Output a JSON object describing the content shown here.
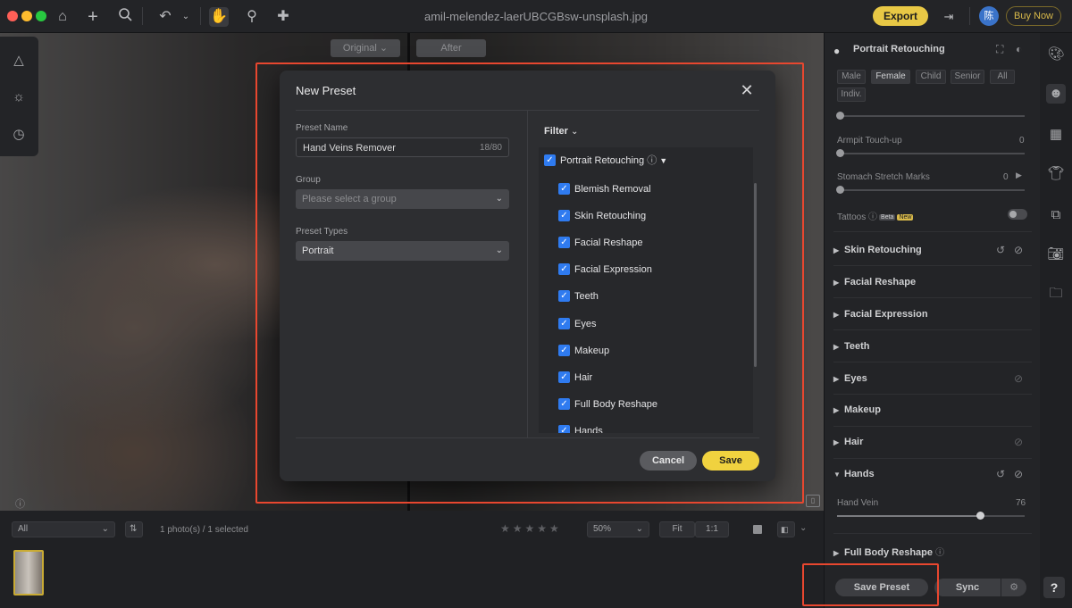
{
  "window": {
    "title": "amil-melendez-laerUBCGBsw-unsplash.jpg"
  },
  "toolbar": {
    "export_label": "Export",
    "avatar_text": "陈",
    "buy_now_label": "Buy Now"
  },
  "viewer": {
    "original_label": "Original",
    "after_label": "After"
  },
  "modal": {
    "title": "New Preset",
    "preset_name_label": "Preset Name",
    "preset_name_value": "Hand Veins Remover",
    "preset_name_count": "18/80",
    "group_label": "Group",
    "group_placeholder": "Please select a group",
    "preset_types_label": "Preset Types",
    "preset_types_value": "Portrait",
    "filter_label": "Filter",
    "filter_root": "Portrait Retouching",
    "filter_items": [
      "Blemish Removal",
      "Skin Retouching",
      "Facial Reshape",
      "Facial Expression",
      "Teeth",
      "Eyes",
      "Makeup",
      "Hair",
      "Full Body Reshape",
      "Hands"
    ],
    "cancel_label": "Cancel",
    "save_label": "Save"
  },
  "bottombar": {
    "filter_value": "All",
    "photo_count": "1 photo(s) / 1 selected",
    "zoom_value": "50%",
    "fit_label": "Fit",
    "one_to_one_label": "1:1"
  },
  "panel": {
    "title": "Portrait Retouching",
    "chips": [
      "Male",
      "Female",
      "Child",
      "Senior",
      "All",
      "Indiv."
    ],
    "armpit_label": "Armpit Touch-up",
    "armpit_value": "0",
    "stomach_label": "Stomach Stretch Marks",
    "stomach_value": "0",
    "tattoos_label": "Tattoos",
    "beta_badge": "Beta",
    "new_badge": "New",
    "sections": [
      "Skin Retouching",
      "Facial Reshape",
      "Facial Expression",
      "Teeth",
      "Eyes",
      "Makeup",
      "Hair",
      "Hands"
    ],
    "hand_vein_label": "Hand Vein",
    "hand_vein_value": "76",
    "hand_vein_level": 0.76,
    "full_body_label": "Full Body Reshape",
    "save_preset_label": "Save Preset",
    "sync_label": "Sync",
    "help_label": "?"
  },
  "colors": {
    "accent_yellow": "#f0d23f",
    "checkbox_blue": "#2f7bf0",
    "highlight_red": "#e8472f"
  }
}
